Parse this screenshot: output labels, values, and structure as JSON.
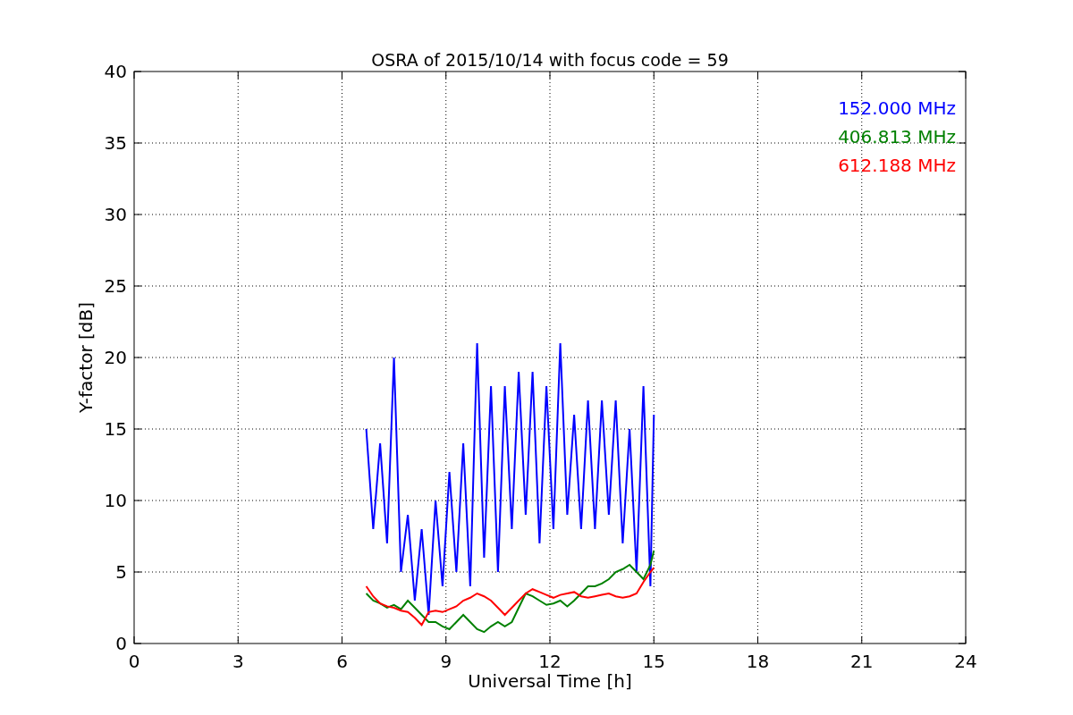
{
  "chart_data": {
    "type": "line",
    "title": "OSRA of 2015/10/14 with focus code = 59",
    "xlabel": "Universal Time [h]",
    "ylabel": "Y-factor [dB]",
    "x": [
      6.7,
      6.9,
      7.1,
      7.3,
      7.5,
      7.7,
      7.9,
      8.1,
      8.3,
      8.5,
      8.7,
      8.9,
      9.1,
      9.3,
      9.5,
      9.7,
      9.9,
      10.1,
      10.3,
      10.5,
      10.7,
      10.9,
      11.1,
      11.3,
      11.5,
      11.7,
      11.9,
      12.1,
      12.3,
      12.5,
      12.7,
      12.9,
      13.1,
      13.3,
      13.5,
      13.7,
      13.9,
      14.1,
      14.3,
      14.5,
      14.7,
      14.9,
      15.0
    ],
    "series": [
      {
        "name": "152.000 MHz",
        "color": "#0000ff",
        "values": [
          15,
          8,
          14,
          7,
          20,
          5,
          9,
          3,
          8,
          2,
          10,
          4,
          12,
          5,
          14,
          4,
          21,
          6,
          18,
          5,
          18,
          8,
          19,
          9,
          19,
          7,
          18,
          8,
          21,
          9,
          16,
          8,
          17,
          8,
          17,
          9,
          17,
          7,
          15,
          5,
          18,
          4,
          16
        ]
      },
      {
        "name": "406.813 MHz",
        "color": "#008000",
        "values": [
          3.5,
          3,
          2.8,
          2.5,
          2.7,
          2.4,
          3,
          2.5,
          2,
          1.5,
          1.5,
          1.2,
          1,
          1.5,
          2,
          1.5,
          1,
          0.8,
          1.2,
          1.5,
          1.2,
          1.5,
          2.5,
          3.5,
          3.3,
          3,
          2.7,
          2.8,
          3,
          2.6,
          3,
          3.5,
          4,
          4,
          4.2,
          4.5,
          5,
          5.2,
          5.5,
          5,
          4.5,
          5.5,
          6.5
        ]
      },
      {
        "name": "612.188 MHz",
        "color": "#ff0000",
        "values": [
          4,
          3.3,
          2.8,
          2.6,
          2.5,
          2.3,
          2.2,
          1.8,
          1.3,
          2.2,
          2.3,
          2.2,
          2.4,
          2.6,
          3,
          3.2,
          3.5,
          3.3,
          3,
          2.5,
          2,
          2.5,
          3,
          3.5,
          3.8,
          3.6,
          3.4,
          3.2,
          3.4,
          3.5,
          3.6,
          3.3,
          3.2,
          3.3,
          3.4,
          3.5,
          3.3,
          3.2,
          3.3,
          3.5,
          4.3,
          5,
          5.3
        ]
      }
    ],
    "grid": true,
    "xlim": [
      0,
      24
    ],
    "ylim": [
      0,
      40
    ],
    "xticks": [
      0,
      3,
      6,
      9,
      12,
      15,
      18,
      21,
      24
    ],
    "yticks": [
      0,
      5,
      10,
      15,
      20,
      25,
      30,
      35,
      40
    ]
  }
}
